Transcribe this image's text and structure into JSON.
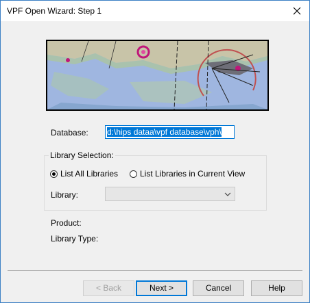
{
  "window": {
    "title": "VPF Open Wizard: Step 1",
    "close_icon": "close-icon"
  },
  "form": {
    "database_label": "Database:",
    "database_value": "d:\\hips dataa\\vpf database\\vph\\",
    "library_selection_label": "Library Selection:",
    "radio_all_label": "List All Libraries",
    "radio_current_label": "List Libraries in Current View",
    "radio_selected": "all",
    "library_label": "Library:",
    "library_value": "",
    "product_label": "Product:",
    "library_type_label": "Library Type:"
  },
  "buttons": {
    "back": "< Back",
    "next": "Next >",
    "cancel": "Cancel",
    "help": "Help"
  },
  "colors": {
    "accent": "#0078d7",
    "map_water": "#9fb6e0",
    "map_land": "#c8c4a8"
  }
}
